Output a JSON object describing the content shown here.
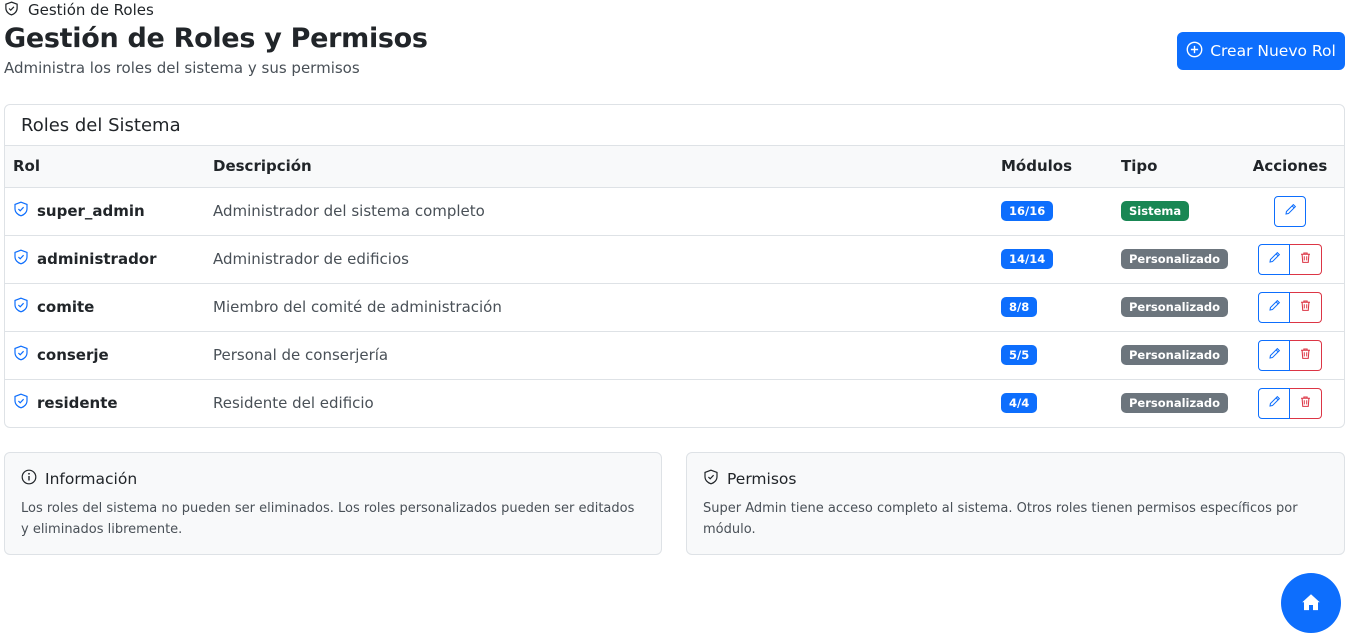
{
  "breadcrumb": {
    "label": "Gestión de Roles",
    "icon": "shield-icon"
  },
  "header": {
    "title": "Gestión de Roles y Permisos",
    "subtitle": "Administra los roles del sistema y sus permisos",
    "create_button": "Crear Nuevo Rol"
  },
  "roles_card": {
    "title": "Roles del Sistema",
    "columns": [
      "Rol",
      "Descripción",
      "Módulos",
      "Tipo",
      "Acciones"
    ],
    "rows": [
      {
        "rol": "super_admin",
        "descripcion": "Administrador del sistema completo",
        "modulos": "16/16",
        "tipo": "Sistema"
      },
      {
        "rol": "administrador",
        "descripcion": "Administrador de edificios",
        "modulos": "14/14",
        "tipo": "Personalizado"
      },
      {
        "rol": "comite",
        "descripcion": "Miembro del comité de administración",
        "modulos": "8/8",
        "tipo": "Personalizado"
      },
      {
        "rol": "conserje",
        "descripcion": "Personal de conserjería",
        "modulos": "5/5",
        "tipo": "Personalizado"
      },
      {
        "rol": "residente",
        "descripcion": "Residente del edificio",
        "modulos": "4/4",
        "tipo": "Personalizado"
      }
    ]
  },
  "info_cards": {
    "informacion": {
      "title": "Información",
      "text": "Los roles del sistema no pueden ser eliminados. Los roles personalizados pueden ser editados y eliminados libremente."
    },
    "permisos": {
      "title": "Permisos",
      "text": "Super Admin tiene acceso completo al sistema. Otros roles tienen permisos específicos por módulo."
    }
  },
  "colors": {
    "primary": "#0d6efd",
    "success": "#198754",
    "secondary": "#6c757d",
    "danger": "#dc3545"
  }
}
